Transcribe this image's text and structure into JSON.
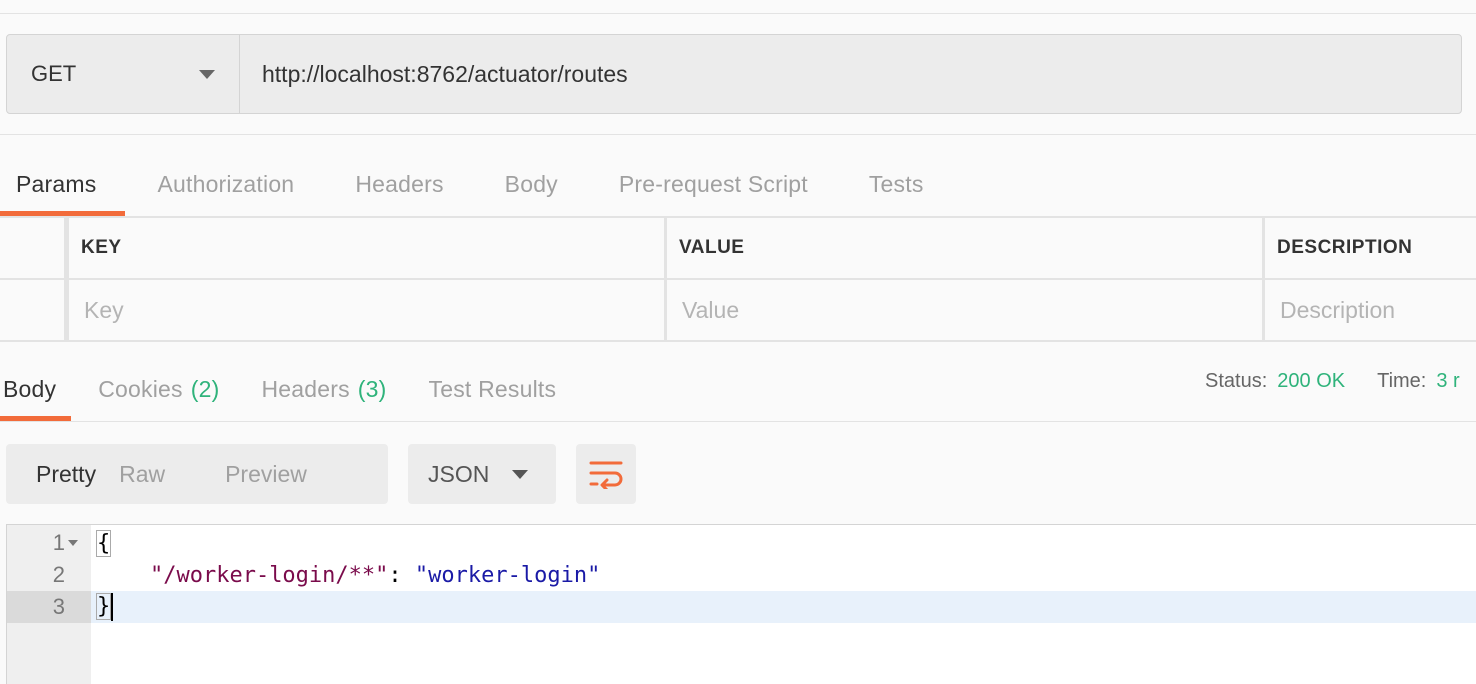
{
  "request": {
    "method": "GET",
    "url": "http://localhost:8762/actuator/routes"
  },
  "request_tabs": [
    {
      "label": "Params",
      "active": true
    },
    {
      "label": "Authorization",
      "active": false
    },
    {
      "label": "Headers",
      "active": false
    },
    {
      "label": "Body",
      "active": false
    },
    {
      "label": "Pre-request Script",
      "active": false
    },
    {
      "label": "Tests",
      "active": false
    }
  ],
  "params_table": {
    "headers": {
      "key": "KEY",
      "value": "VALUE",
      "description": "DESCRIPTION"
    },
    "placeholders": {
      "key": "Key",
      "value": "Value",
      "description": "Description"
    }
  },
  "response_tabs": [
    {
      "label": "Body",
      "count": "",
      "active": true
    },
    {
      "label": "Cookies",
      "count": "(2)",
      "active": false
    },
    {
      "label": "Headers",
      "count": "(3)",
      "active": false
    },
    {
      "label": "Test Results",
      "count": "",
      "active": false
    }
  ],
  "response_status": {
    "status_label": "Status:",
    "status_value": "200 OK",
    "time_label": "Time:",
    "time_value": "3 r"
  },
  "view_modes": [
    {
      "label": "Pretty",
      "active": true
    },
    {
      "label": "Raw",
      "active": false
    },
    {
      "label": "Preview",
      "active": false
    }
  ],
  "format": "JSON",
  "editor": {
    "lines": [
      {
        "num": "1",
        "open": "{"
      },
      {
        "num": "2",
        "key": "\"/worker-login/**\"",
        "sep": ": ",
        "value": "\"worker-login\""
      },
      {
        "num": "3",
        "close": "}"
      }
    ]
  },
  "colors": {
    "accent": "#f26b3a",
    "success": "#2fb37b",
    "json_key": "#7a0b4b",
    "json_string": "#1a1aa6"
  }
}
